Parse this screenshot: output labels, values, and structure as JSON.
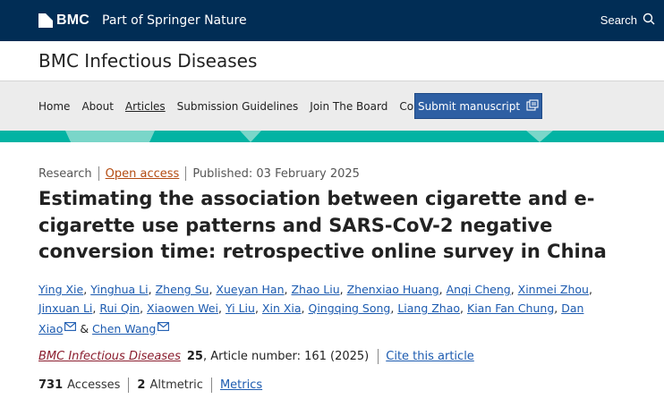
{
  "header": {
    "brand_name": "BMC",
    "brand_tagline": "Part of Springer Nature",
    "search_label": "Search"
  },
  "journal": {
    "title": "BMC Infectious Diseases"
  },
  "nav": {
    "items": [
      "Home",
      "About",
      "Articles",
      "Submission Guidelines",
      "Join The Board",
      "Collections"
    ],
    "active": "Articles",
    "submit_label": "Submit manuscript"
  },
  "article": {
    "type": "Research",
    "access": "Open access",
    "published": "Published: 03 February 2025",
    "title": "Estimating the association between cigarette and e-cigarette use patterns and SARS-CoV-2 negative conversion time: retrospective online survey in China",
    "authors": [
      {
        "name": "Ying Xie",
        "email": false
      },
      {
        "name": "Yinghua Li",
        "email": false
      },
      {
        "name": "Zheng Su",
        "email": false
      },
      {
        "name": "Xueyan Han",
        "email": false
      },
      {
        "name": "Zhao Liu",
        "email": false
      },
      {
        "name": "Zhenxiao Huang",
        "email": false
      },
      {
        "name": "Anqi Cheng",
        "email": false
      },
      {
        "name": "Xinmei Zhou",
        "email": false
      },
      {
        "name": "Jinxuan Li",
        "email": false
      },
      {
        "name": "Rui Qin",
        "email": false
      },
      {
        "name": "Xiaowen Wei",
        "email": false
      },
      {
        "name": "Yi Liu",
        "email": false
      },
      {
        "name": "Xin Xia",
        "email": false
      },
      {
        "name": "Qingqing Song",
        "email": false
      },
      {
        "name": "Liang Zhao",
        "email": false
      },
      {
        "name": "Kian Fan Chung",
        "email": false
      },
      {
        "name": "Dan Xiao",
        "email": true
      },
      {
        "name": "Chen Wang",
        "email": true
      }
    ],
    "journal_name": "BMC Infectious Diseases",
    "volume": "25",
    "article_number": ", Article number: 161 (2025)",
    "cite_label": "Cite this article"
  },
  "metrics": {
    "accesses_count": "731",
    "accesses_label": "Accesses",
    "altmetric_count": "2",
    "altmetric_label": "Altmetric",
    "metrics_link": "Metrics"
  },
  "colors": {
    "header_bg": "#012d55",
    "teal": "#02b3a3",
    "link": "#1c5bb0",
    "open_access": "#b44c12",
    "journal_link": "#8b1e2f",
    "submit_bg": "#2e5fa3"
  }
}
